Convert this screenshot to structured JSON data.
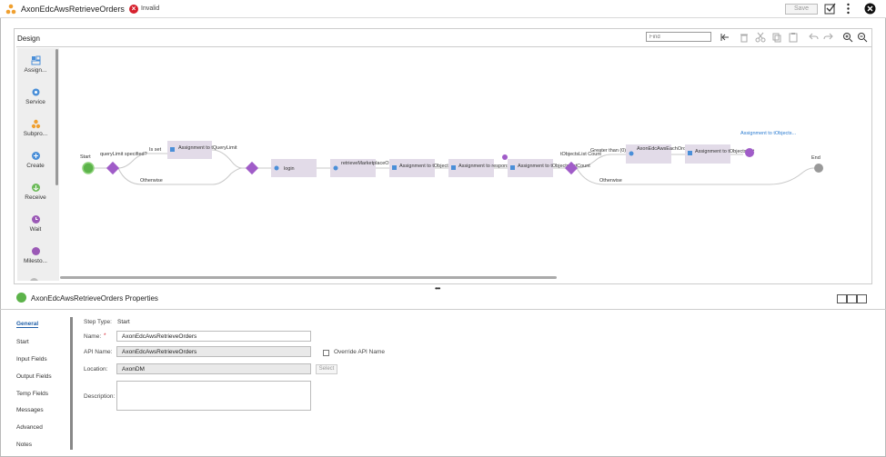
{
  "header": {
    "app_title": "AxonEdcAwsRetrieveOrders",
    "status_text": "Invalid",
    "save_label": "Save"
  },
  "design": {
    "title": "Design",
    "find_placeholder": "Find"
  },
  "palette": {
    "items": [
      {
        "label": "Assign...",
        "icon": "assignment-icon",
        "color": "#4a8fd8"
      },
      {
        "label": "Service",
        "icon": "service-icon",
        "color": "#4a8fd8"
      },
      {
        "label": "Subpro...",
        "icon": "subprocess-icon",
        "color": "#f0a030"
      },
      {
        "label": "Create",
        "icon": "create-icon",
        "color": "#4a8fd8"
      },
      {
        "label": "Receive",
        "icon": "receive-icon",
        "color": "#6dbb5a"
      },
      {
        "label": "Wait",
        "icon": "wait-icon",
        "color": "#9b59b6"
      },
      {
        "label": "Milesto...",
        "icon": "milestone-icon",
        "color": "#9b59b6"
      }
    ]
  },
  "flow": {
    "start_label": "Start",
    "end_label": "End",
    "decision1_label": "queryLimit specified?",
    "is_set_label": "Is set",
    "otherwise1_label": "Otherwise",
    "assign_querylimit": "Assignment to tQueryLimit",
    "login_label": "login",
    "retrieve_label": "retrieveMarketplaceOrderInventory",
    "assign_tobjects": "Assignment to tObjectsList",
    "assign_response": "Assignment to response",
    "assign_count": "Assignment to tObjectsListCount",
    "decision2_label": "tObjectsList Count",
    "greater_label": "Greater than (0)",
    "otherwise2_label": "Otherwise",
    "axon_each_order": "AxonEdcAwsEachOrder",
    "assign_tobjects2": "Assignment to tObjectsList",
    "assign_pending": "Assignment to tObjects..."
  },
  "properties": {
    "title": "AxonEdcAwsRetrieveOrders Properties",
    "nav": [
      "General",
      "Start",
      "Input Fields",
      "Output Fields",
      "Temp Fields",
      "Messages",
      "Advanced",
      "Notes"
    ],
    "step_type_label": "Step Type:",
    "step_type_value": "Start",
    "name_label": "Name:",
    "name_value": "AxonEdcAwsRetrieveOrders",
    "api_name_label": "API Name:",
    "api_name_value": "AxonEdcAwsRetrieveOrders",
    "override_label": "Override API Name",
    "location_label": "Location:",
    "location_value": "AxonDM",
    "select_label": "Select",
    "description_label": "Description:"
  },
  "colors": {
    "decision": "#a05cc8",
    "start_green": "#5cb34a",
    "node_bg": "#e2dbe8",
    "end_grey": "#999999",
    "invalid_red": "#d6202d"
  }
}
